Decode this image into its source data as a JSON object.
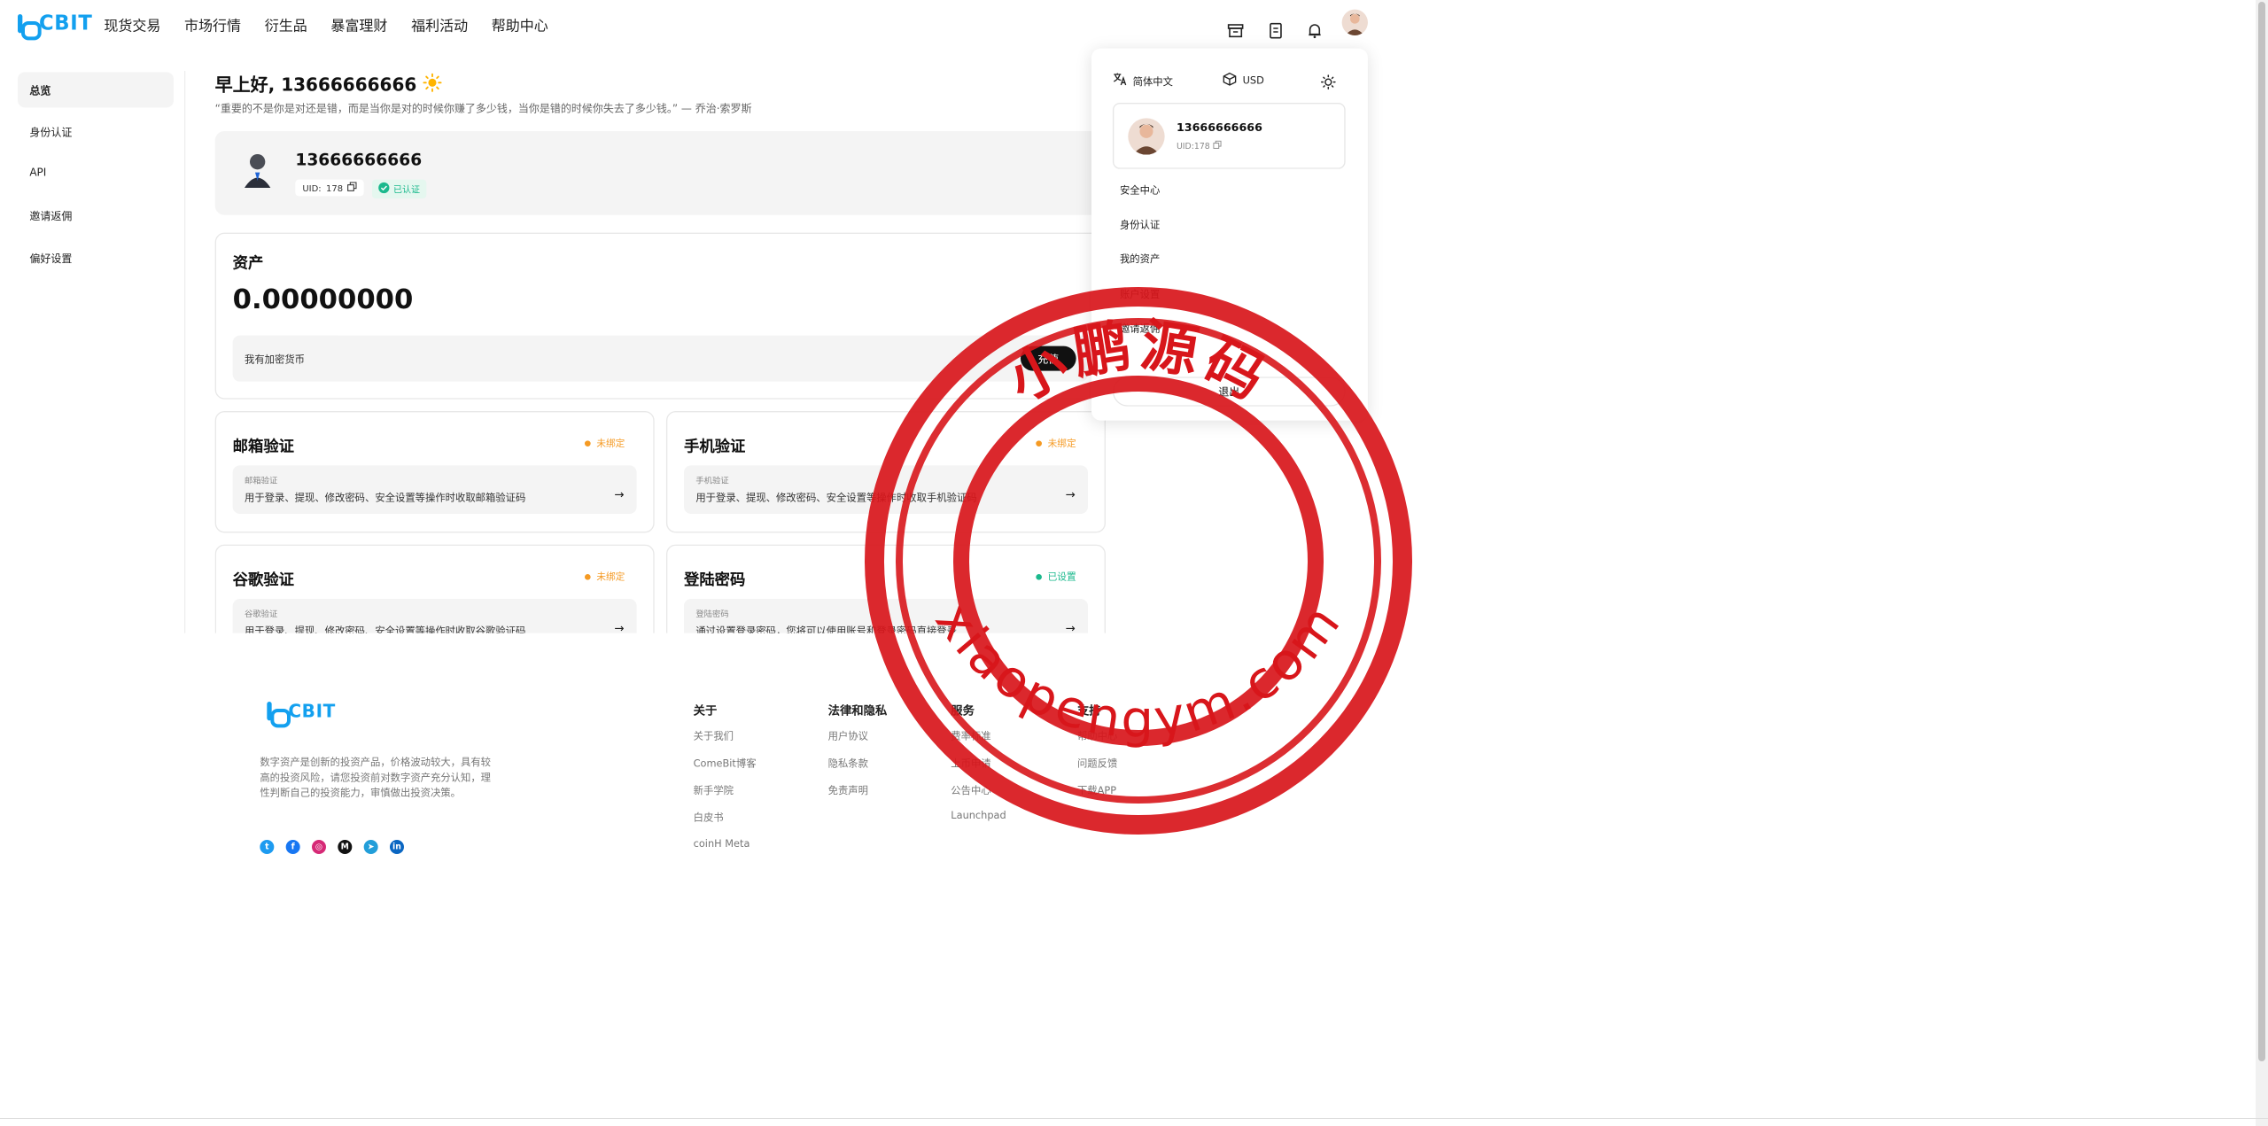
{
  "header": {
    "logo_text": "CBIT",
    "nav": [
      "现货交易",
      "市场行情",
      "衍生品",
      "暴富理财",
      "福利活动",
      "帮助中心"
    ],
    "icons": [
      "archive-icon",
      "document-icon",
      "bell-icon",
      "avatar"
    ]
  },
  "sidebar": {
    "items": [
      {
        "label": "总览",
        "active": true
      },
      {
        "label": "身份认证",
        "active": false
      },
      {
        "label": "API",
        "active": false
      },
      {
        "label": "邀请返佣",
        "active": false
      },
      {
        "label": "偏好设置",
        "active": false
      }
    ]
  },
  "greeting": {
    "text": "早上好, 13666666666",
    "icon": "sun-icon",
    "quote": "“重要的不是你是对还是错，而是当你是对的时候你赚了多少钱，当你是错的时候你失去了多少钱。” — 乔治·索罗斯"
  },
  "profile": {
    "name": "13666666666",
    "uid_label": "UID:",
    "uid_value": "178",
    "verified_label": "已认证"
  },
  "assets": {
    "title": "资产",
    "value": "0.00000000",
    "crypto_label": "我有加密货币",
    "deposit_button": "充值"
  },
  "security_cards": [
    {
      "title": "邮箱验证",
      "status": "未绑定",
      "sub_label": "邮箱验证",
      "desc": "用于登录、提现、修改密码、安全设置等操作时收取邮箱验证码"
    },
    {
      "title": "手机验证",
      "status": "未绑定",
      "sub_label": "手机验证",
      "desc": "用于登录、提现、修改密码、安全设置等操作时收取手机验证码"
    },
    {
      "title": "谷歌验证",
      "status": "未绑定",
      "sub_label": "谷歌验证",
      "desc": "用于登录、提现、修改密码、安全设置等操作时收取谷歌验证码"
    },
    {
      "title": "登陆密码",
      "status": "已设置",
      "sub_label": "登陆密码",
      "desc": "通过设置登录密码，您将可以使用账号和登录密码直接登录"
    }
  ],
  "dropdown": {
    "language": "简体中文",
    "currency": "USD",
    "name": "13666666666",
    "uid": "UID:178",
    "items": [
      "安全中心",
      "身份认证",
      "我的资产",
      "账户设置",
      "邀请返佣"
    ],
    "logout": "退出"
  },
  "footer": {
    "logo_text": "CBIT",
    "disclaimer": "数字资产是创新的投资产品，价格波动较大，具有较高的投资风险，请您投资前对数字资产充分认知，理性判断自己的投资能力，审慎做出投资决策。",
    "columns": [
      {
        "title": "关于",
        "links": [
          "关于我们",
          "ComeBit博客",
          "新手学院",
          "白皮书",
          "coinH Meta"
        ]
      },
      {
        "title": "法律和隐私",
        "links": [
          "用户协议",
          "隐私条款",
          "免责声明"
        ]
      },
      {
        "title": "服务",
        "links": [
          "费率标准",
          "上币申请",
          "公告中心",
          "Launchpad"
        ]
      },
      {
        "title": "支持",
        "links": [
          "帮助中心",
          "问题反馈",
          "下载APP"
        ]
      }
    ],
    "social": [
      "twitter-icon",
      "facebook-icon",
      "instagram-icon",
      "medium-icon",
      "telegram-icon",
      "linkedin-icon"
    ]
  },
  "watermark": {
    "top_text": "小鹏源码",
    "bottom_text": "xiaopengym.com",
    "color": "#d8161b"
  },
  "colors": {
    "brand": "#13a0ef",
    "warning": "#f59a23",
    "success": "#1bb98d",
    "dark": "#111111"
  }
}
